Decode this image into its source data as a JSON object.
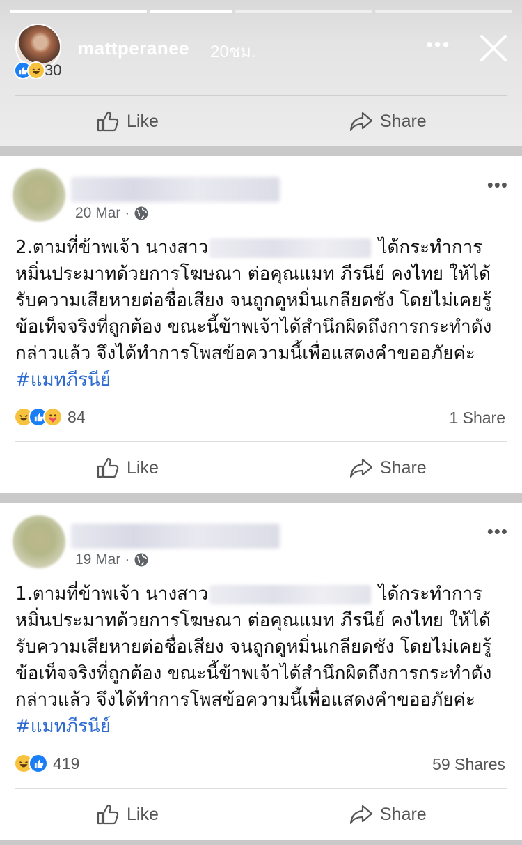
{
  "story": {
    "username": "mattperanee",
    "time": "20ชม.",
    "reaction_count": "30",
    "like_label": "Like",
    "share_label": "Share"
  },
  "posts": [
    {
      "date": "20 Mar",
      "text_before": "2.ตามที่ข้าพเจ้า นางสาว",
      "text_after": " ได้กระทำการหมิ่นประมาทด้วยการโฆษณา ต่อคุณแมท ภีรนีย์ คงไทย ให้ได้รับความเสียหายต่อชื่อเสียง จนถูกดูหมิ่นเกลียดชัง โดยไม่เคยรู้ข้อเท็จจริงที่ถูกต้อง ขณะนี้ข้าพเจ้าได้สำนึกผิดถึงการกระทำดังกล่าวแล้ว จึงได้ทำการโพสข้อความนี้เพื่อแสดงคำขออภัยค่ะ ",
      "hashtag": "#แมทภีรนีย์",
      "reaction_count": "84",
      "shares": "1 Share",
      "like_label": "Like",
      "share_label": "Share",
      "reactions": [
        "haha",
        "like",
        "care"
      ]
    },
    {
      "date": "19 Mar",
      "text_before": "1.ตามที่ข้าพเจ้า นางสาว",
      "text_after": " ได้กระทำการหมิ่นประมาทด้วยการโฆษณา ต่อคุณแมท ภีรนีย์ คงไทย ให้ได้รับความเสียหายต่อชื่อเสียง จนถูกดูหมิ่นเกลียดชัง โดยไม่เคยรู้ข้อเท็จจริงที่ถูกต้อง ขณะนี้ข้าพเจ้าได้สำนึกผิดถึงการกระทำดังกล่าวแล้ว จึงได้ทำการโพสข้อความนี้เพื่อแสดงคำขออภัยค่ะ ",
      "hashtag": "#แมทภีรนีย์",
      "reaction_count": "419",
      "shares": "59 Shares",
      "like_label": "Like",
      "share_label": "Share",
      "reactions": [
        "haha",
        "like"
      ]
    }
  ],
  "colors": {
    "like_blue": "#1a7ff5",
    "haha_yellow": "#f7c33f",
    "hashtag_blue": "#2d6bd1"
  }
}
